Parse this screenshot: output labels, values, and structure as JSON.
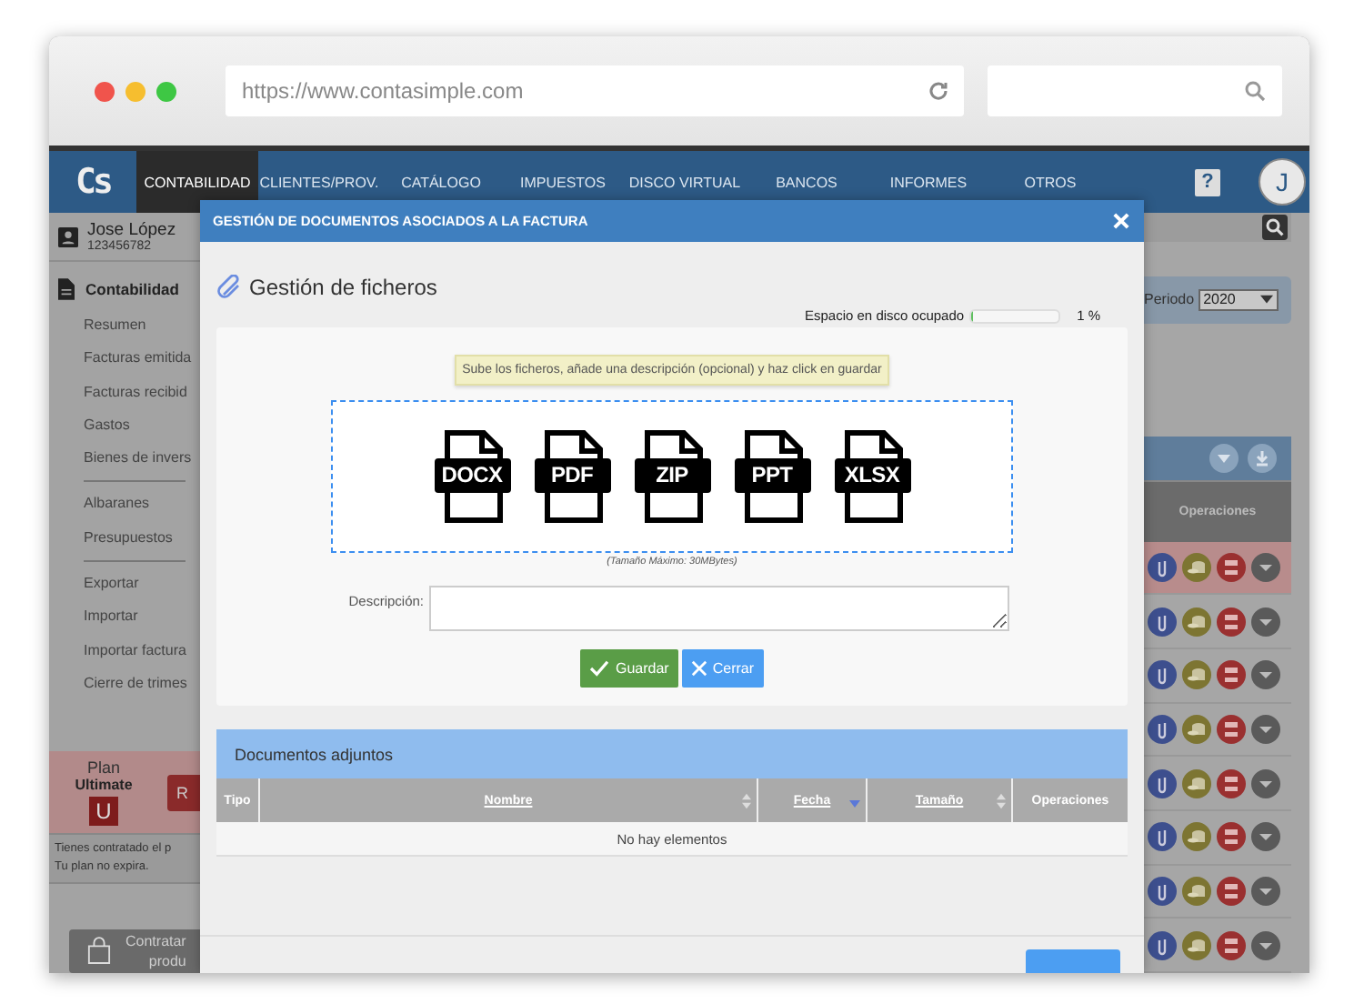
{
  "browser": {
    "url": "https://www.contasimple.com"
  },
  "nav": {
    "logo": "Cs",
    "tabs": [
      {
        "label": "CONTABILIDAD",
        "selected": true
      },
      {
        "label": "CLIENTES/PROV.",
        "selected": false
      },
      {
        "label": "CATÁLOGO",
        "selected": false
      },
      {
        "label": "IMPUESTOS",
        "selected": false
      },
      {
        "label": "DISCO VIRTUAL",
        "selected": false
      },
      {
        "label": "BANCOS",
        "selected": false
      },
      {
        "label": "INFORMES",
        "selected": false
      },
      {
        "label": "OTROS",
        "selected": false
      }
    ],
    "help": "?",
    "avatar": "J"
  },
  "sidebar": {
    "user": {
      "name": "Jose López",
      "id": "123456782"
    },
    "section": "Contabilidad",
    "groups": [
      [
        "Resumen",
        "Facturas emitida",
        "Facturas recibid",
        "Gastos",
        "Bienes de invers"
      ],
      [
        "Albaranes",
        "Presupuestos"
      ],
      [
        "Exportar",
        "Importar",
        "Importar factura",
        "Cierre de trimes"
      ]
    ],
    "plan": {
      "label": "Plan",
      "name": "Ultimate",
      "badge": "U",
      "button": "R"
    },
    "plan_note": [
      "Tienes contratado el p",
      "Tu plan no expira."
    ],
    "buy_button": [
      "Contratar",
      "produ"
    ]
  },
  "background": {
    "period_label": "Periodo",
    "period_value": "2020",
    "operations_header": "Operaciones",
    "rows": [
      {
        "selected": true
      },
      {
        "selected": false
      },
      {
        "selected": false
      },
      {
        "selected": false
      },
      {
        "selected": false
      },
      {
        "selected": false
      },
      {
        "selected": false
      },
      {
        "selected": false
      }
    ]
  },
  "modal": {
    "title": "GESTIÓN DE DOCUMENTOS ASOCIADOS A LA FACTURA",
    "heading": "Gestión de ficheros",
    "disk": {
      "label": "Espacio en disco ocupado",
      "level": 0.01,
      "reading": "1 %"
    },
    "tip": "Sube los ficheros, añade una descripción (opcional) y haz click en guardar",
    "file_types": [
      "DOCX",
      "PDF",
      "ZIP",
      "PPT",
      "XLSX"
    ],
    "max_size": "(Tamaño Máximo: 30MBytes)",
    "description": {
      "label": "Descripción:"
    },
    "buttons": [
      {
        "kind": "save",
        "label": "Guardar"
      },
      {
        "kind": "close",
        "label": "Cerrar"
      }
    ],
    "attachments": {
      "title": "Documentos adjuntos",
      "columns": [
        {
          "label": "Tipo",
          "sortable": false,
          "sorted": false
        },
        {
          "label": "Nombre",
          "sortable": true,
          "sorted": false
        },
        {
          "label": "Fecha",
          "sortable": true,
          "sorted": true
        },
        {
          "label": "Tamaño",
          "sortable": true,
          "sorted": false
        },
        {
          "label": "Operaciones",
          "sortable": false,
          "sorted": false
        }
      ],
      "empty": "No hay elementos"
    }
  }
}
